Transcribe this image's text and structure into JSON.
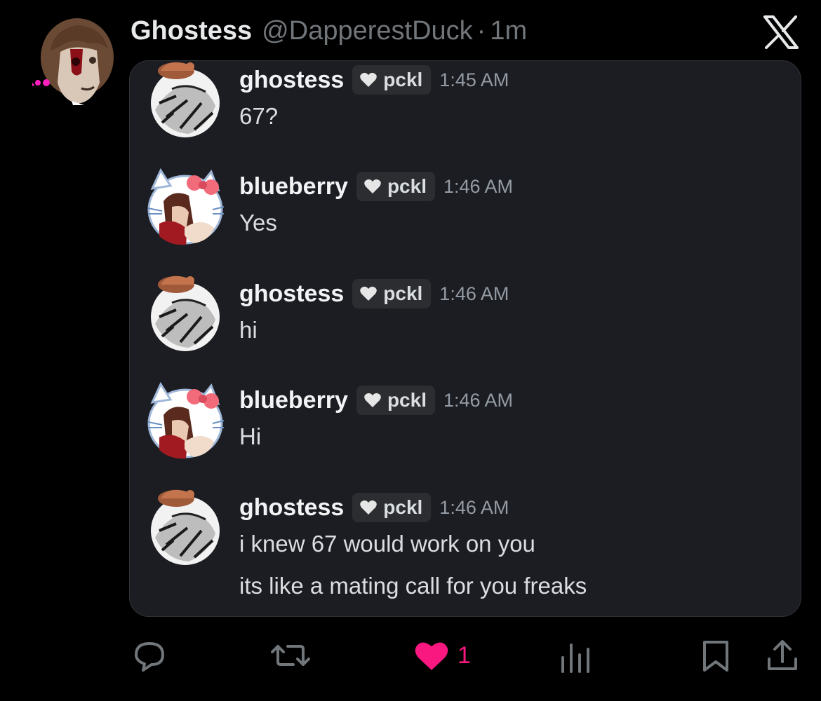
{
  "tweet": {
    "display_name": "Ghostess",
    "handle": "@DapperestDuck",
    "separator": "·",
    "age": "1m"
  },
  "messages": [
    {
      "user": "ghostess",
      "tag": "pckl",
      "time": "1:45 AM",
      "lines": [
        "67?"
      ],
      "avatar": "ghostess-avatar"
    },
    {
      "user": "blueberry",
      "tag": "pckl",
      "time": "1:46 AM",
      "lines": [
        "Yes"
      ],
      "avatar": "blueberry-avatar"
    },
    {
      "user": "ghostess",
      "tag": "pckl",
      "time": "1:46 AM",
      "lines": [
        "hi"
      ],
      "avatar": "ghostess-avatar"
    },
    {
      "user": "blueberry",
      "tag": "pckl",
      "time": "1:46 AM",
      "lines": [
        "Hi"
      ],
      "avatar": "blueberry-avatar"
    },
    {
      "user": "ghostess",
      "tag": "pckl",
      "time": "1:46 AM",
      "lines": [
        "i knew 67 would work on you",
        "its like a mating call for you freaks"
      ],
      "avatar": "ghostess-avatar"
    }
  ],
  "actions": {
    "reply_icon": "reply-icon",
    "retweet_icon": "retweet-icon",
    "like_icon": "heart-icon",
    "like_count": "1",
    "views_icon": "views-icon",
    "bookmark_icon": "bookmark-icon",
    "share_icon": "share-icon"
  },
  "colors": {
    "background": "#000000",
    "card": "#1c1d22",
    "like": "#f91880",
    "muted": "#71767b"
  }
}
